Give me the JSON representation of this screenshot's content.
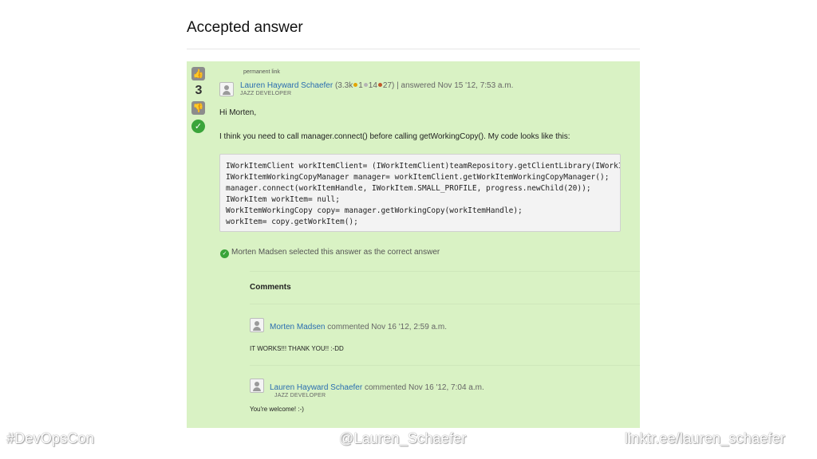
{
  "slide": {
    "title": "Accepted answer"
  },
  "answer": {
    "permalink_label": "permanent link",
    "vote_count": "3",
    "upvote_glyph": "👍",
    "downvote_glyph": "👎",
    "accepted_glyph": "✓",
    "author": "Lauren Hayward Schaefer",
    "reputation": "(3.3k",
    "badge_gold": "1",
    "badge_silver": "14",
    "badge_bronze": "27)",
    "answered_meta": "| answered Nov 15 '12, 7:53 a.m.",
    "author_role": "JAZZ DEVELOPER",
    "greeting": "Hi Morten,",
    "paragraph": "I think you need to call manager.connect() before calling getWorkingCopy().  My code looks like this:",
    "code_lines": [
      "IWorkItemClient workItemClient= (IWorkItemClient)teamRepository.getClientLibrary(IWorkItemClient.class);",
      "IWorkItemWorkingCopyManager manager= workItemClient.getWorkItemWorkingCopyManager();",
      "manager.connect(workItemHandle, IWorkItem.SMALL_PROFILE, progress.newChild(20));",
      "IWorkItem workItem= null;",
      "WorkItemWorkingCopy copy= manager.getWorkingCopy(workItemHandle);",
      "workItem= copy.getWorkItem();"
    ],
    "selected_note": "Morten Madsen selected this answer as the correct answer"
  },
  "comments": {
    "heading": "Comments",
    "items": [
      {
        "author": "Morten Madsen",
        "meta": "commented Nov 16 '12, 2:59 a.m.",
        "role": "",
        "text": "IT WORKS!!! THANK YOU!! :-DD"
      },
      {
        "author": "Lauren Hayward Schaefer",
        "meta": "commented Nov 16 '12, 7:04 a.m.",
        "role": "JAZZ DEVELOPER",
        "text": "You're welcome! :-)"
      }
    ]
  },
  "footer": {
    "hashtag": "#DevOpsCon",
    "handle": "@Lauren_Schaefer",
    "link": "linktr.ee/lauren_schaefer"
  },
  "colors": {
    "panel_bg": "#d9f2c4",
    "link": "#2a6db0",
    "accepted": "#3aa43a",
    "badge_gold": "#e2a400",
    "badge_silver": "#b4b4b4",
    "badge_bronze": "#c0592b"
  }
}
